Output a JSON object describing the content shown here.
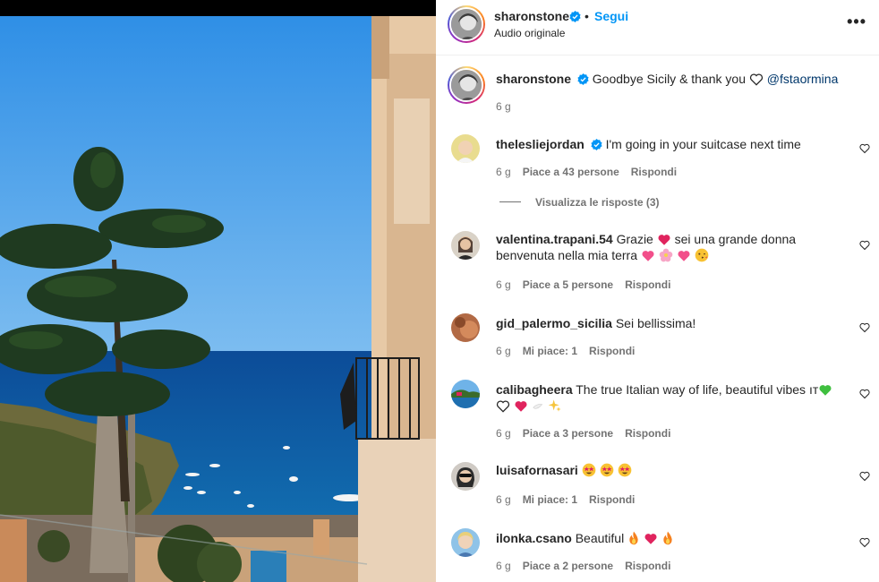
{
  "post": {
    "author": "sharonstone",
    "follow_label": "Segui",
    "separator": "•",
    "audio": "Audio originale",
    "more_icon": "more-options-icon",
    "more_label": "•••"
  },
  "caption": {
    "username": "sharonstone",
    "text": "Goodbye Sicily & thank you",
    "mention": "@fstaormina",
    "time": "6 g"
  },
  "comments": [
    {
      "username": "thelesliejordan",
      "verified": true,
      "text": "I'm going in your suitcase next time",
      "time": "6 g",
      "likes": "Piace a 43 persone",
      "reply": "Rispondi"
    },
    {
      "username": "valentina.trapani.54",
      "verified": false,
      "text": "Grazie",
      "text2": "sei una grande donna",
      "text3": "benvenuta nella mia terra",
      "time": "6 g",
      "likes": "Piace a 5 persone",
      "reply": "Rispondi"
    },
    {
      "username": "gid_palermo_sicilia",
      "verified": false,
      "text": "Sei bellissima!",
      "time": "6 g",
      "likes": "Mi piace: 1",
      "reply": "Rispondi"
    },
    {
      "username": "calibagheera",
      "verified": false,
      "text": "The true Italian way of life, beautiful vibes",
      "text_tail": "ıт",
      "time": "6 g",
      "likes": "Piace a 3 persone",
      "reply": "Rispondi"
    },
    {
      "username": "luisafornasari",
      "verified": false,
      "text": "",
      "time": "6 g",
      "likes": "Mi piace: 1",
      "reply": "Rispondi"
    },
    {
      "username": "ilonka.csano",
      "verified": false,
      "text": "Beautiful",
      "time": "6 g",
      "likes": "Piace a 2 persone",
      "reply": "Rispondi"
    }
  ],
  "view_replies": "Visualizza le risposte (3)",
  "colors": {
    "link": "#0095f6",
    "mention": "#00376b",
    "meta": "#737373",
    "verified": "#0095f6"
  }
}
